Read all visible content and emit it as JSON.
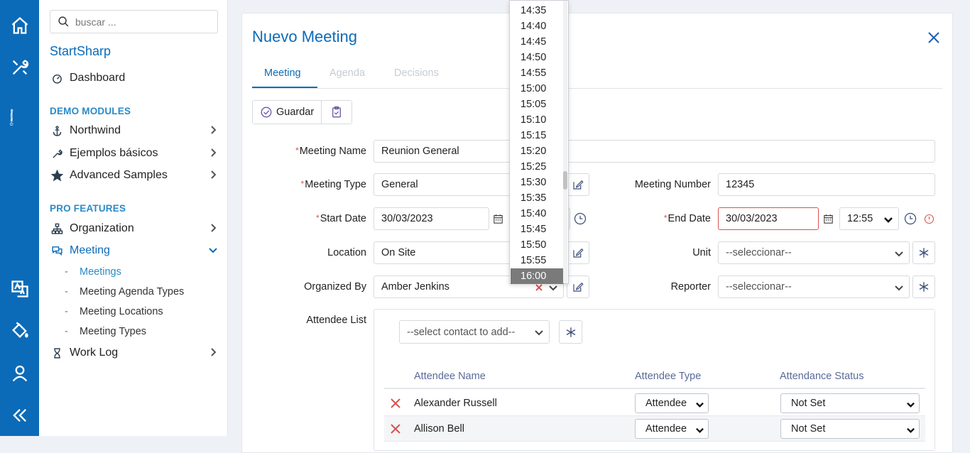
{
  "rail": {
    "brand": "StartSharp",
    "icons": [
      "home-icon",
      "tools-icon",
      "logo-icon",
      "translate-icon",
      "paint-bucket-icon",
      "user-icon",
      "collapse-icon"
    ]
  },
  "sidebar": {
    "search_placeholder": "buscar ...",
    "title": "StartSharp",
    "dashboard": "Dashboard",
    "section_demo": "DEMO MODULES",
    "northwind": "Northwind",
    "basic_samples": "Ejemplos básicos",
    "advanced_samples": "Advanced Samples",
    "section_pro": "PRO FEATURES",
    "organization": "Organization",
    "meeting": "Meeting",
    "meeting_subitems": [
      "Meetings",
      "Meeting Agenda Types",
      "Meeting Locations",
      "Meeting Types"
    ],
    "work_log": "Work Log"
  },
  "dialog": {
    "title": "Nuevo Meeting",
    "tabs": [
      "Meeting",
      "Agenda",
      "Decisions"
    ],
    "save_label": "Guardar",
    "labels": {
      "meeting_name": "Meeting Name",
      "meeting_type": "Meeting Type",
      "start_date": "Start Date",
      "location": "Location",
      "organized_by": "Organized By",
      "attendee_list": "Attendee List",
      "meeting_number": "Meeting Number",
      "end_date": "End Date",
      "unit": "Unit",
      "reporter": "Reporter"
    },
    "values": {
      "meeting_name": "Reunion General",
      "meeting_type": "General",
      "start_date": "30/03/2023",
      "location": "On Site",
      "organized_by": "Amber Jenkins",
      "meeting_number": "12345",
      "end_date": "30/03/2023",
      "end_time": "12:55",
      "unit": "--seleccionar--",
      "reporter": "--seleccionar--",
      "contact_select": "--select contact to add--"
    },
    "attendee_table": {
      "headers": [
        "Attendee Name",
        "Attendee Type",
        "Attendance Status"
      ],
      "rows": [
        {
          "name": "Alexander Russell",
          "type": "Attendee",
          "status": "Not Set"
        },
        {
          "name": "Allison Bell",
          "type": "Attendee",
          "status": "Not Set"
        }
      ]
    }
  },
  "time_dropdown": {
    "options": [
      "14:35",
      "14:40",
      "14:45",
      "14:50",
      "14:55",
      "15:00",
      "15:05",
      "15:10",
      "15:15",
      "15:20",
      "15:25",
      "15:30",
      "15:35",
      "15:40",
      "15:45",
      "15:50",
      "15:55",
      "16:00"
    ],
    "highlighted": "16:00"
  },
  "colors": {
    "brand_blue": "#0b6bb8",
    "required_red": "#d9534f",
    "header_text": "#5b6b99"
  }
}
